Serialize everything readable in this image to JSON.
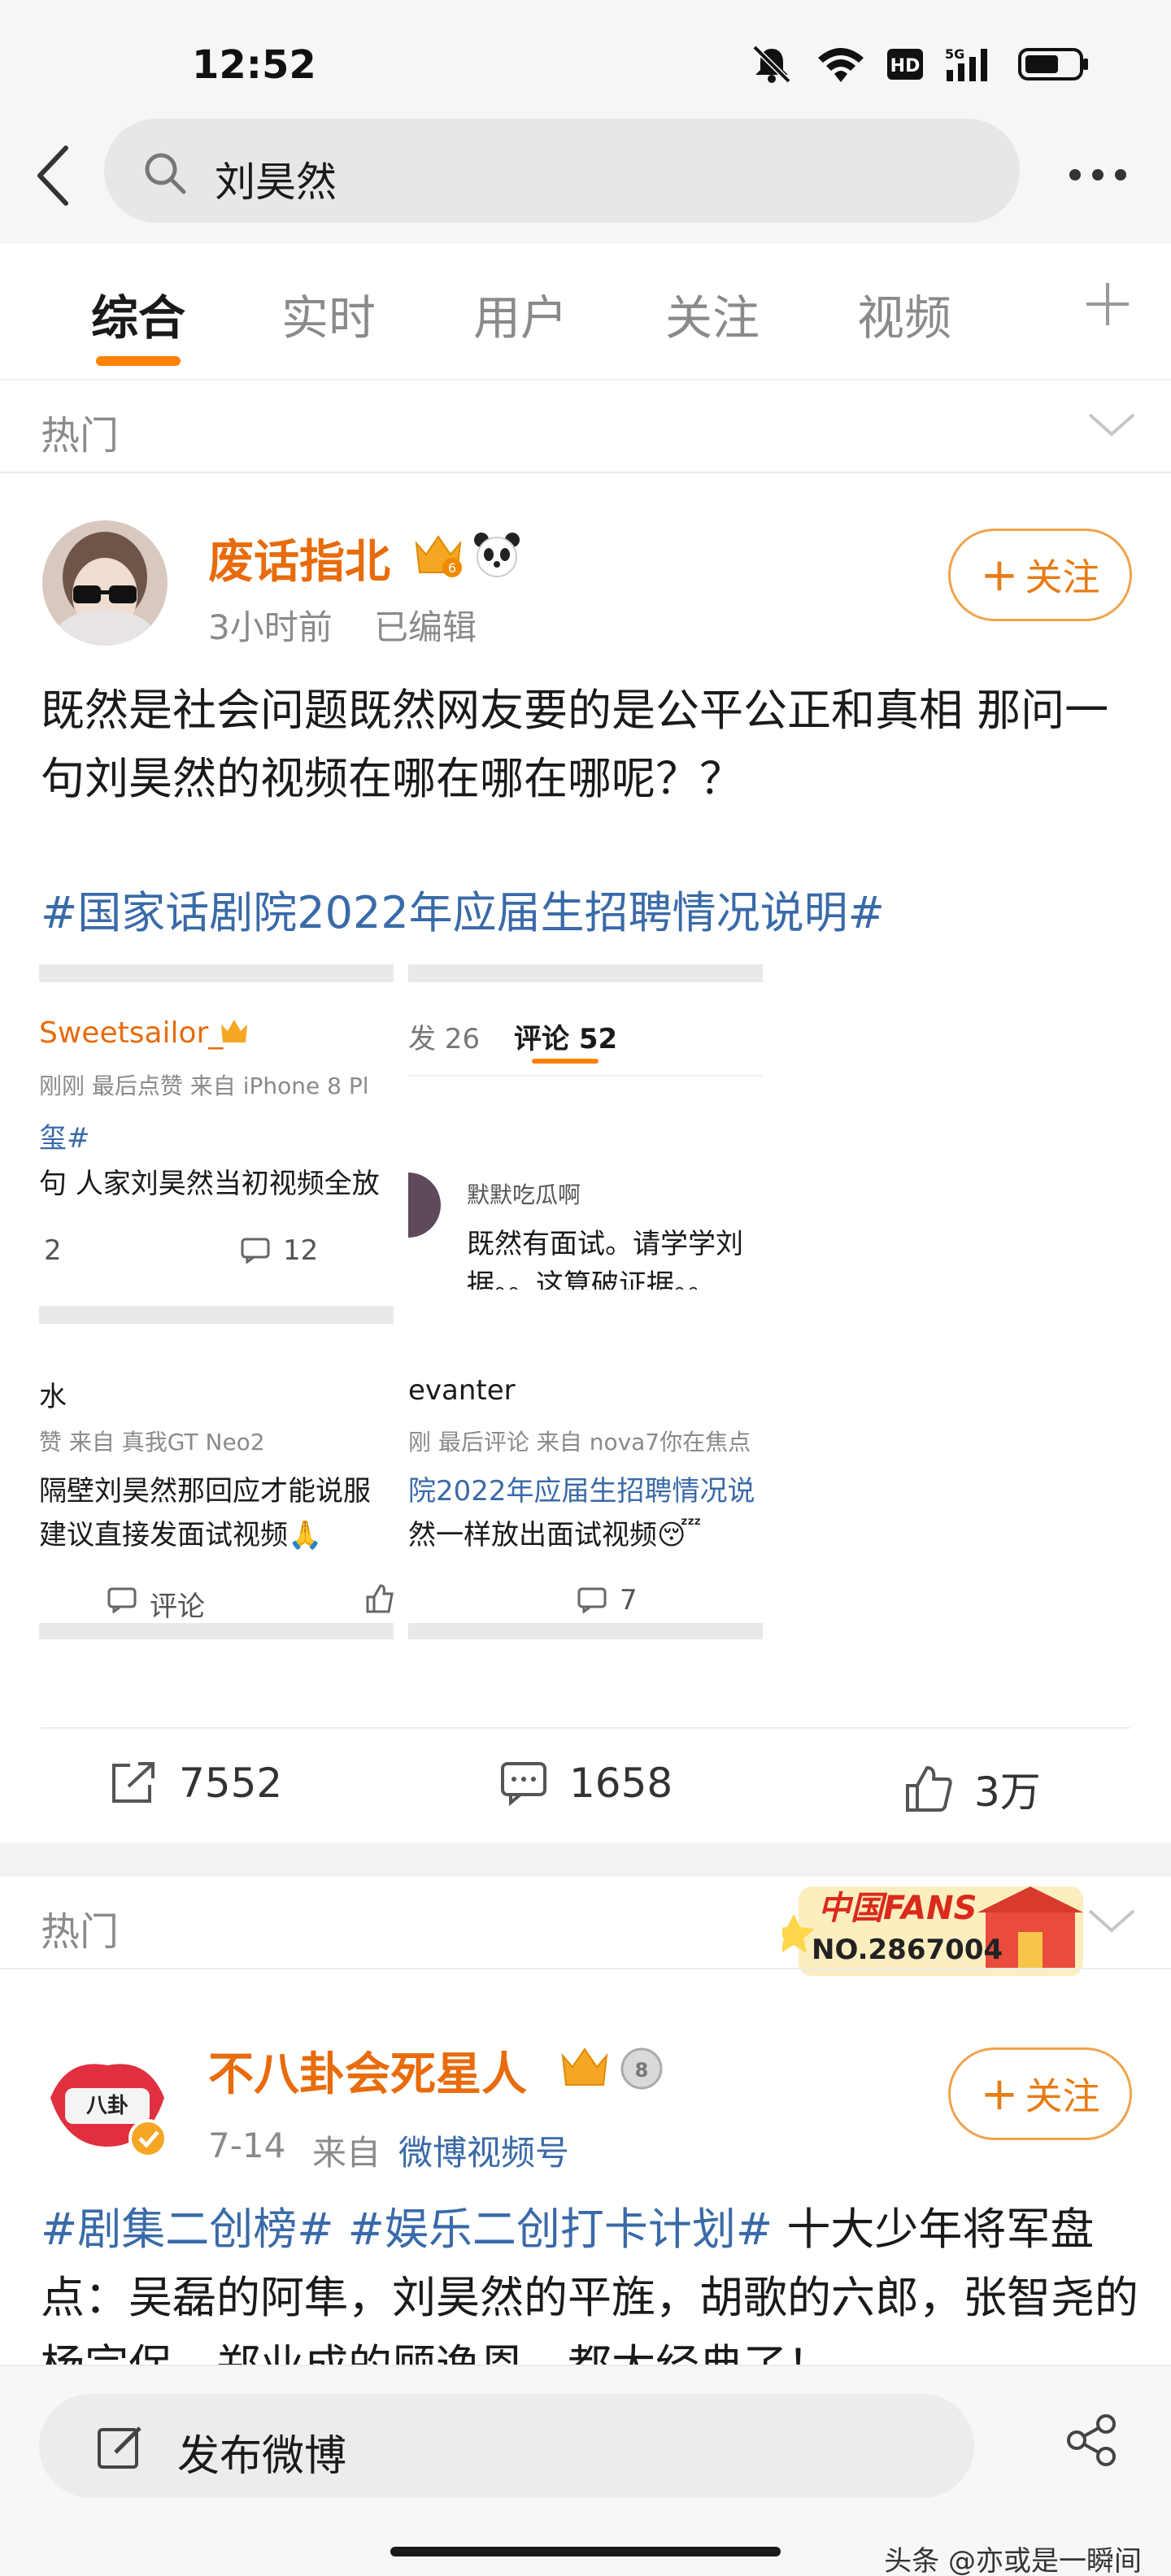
{
  "status_bar": {
    "time": "12:52"
  },
  "search": {
    "query": "刘昊然"
  },
  "tabs": [
    {
      "label": "综合"
    },
    {
      "label": "实时"
    },
    {
      "label": "用户"
    },
    {
      "label": "关注"
    },
    {
      "label": "视频"
    }
  ],
  "sections": [
    {
      "label": "热门"
    },
    {
      "label": "热门"
    }
  ],
  "posts": [
    {
      "author": "废话指北",
      "time": "3小时前",
      "edited": "已编辑",
      "follow_label": "关注",
      "body": "既然是社会问题既然网友要的是公平公正和真相 那问一句刘昊然的视频在哪在哪在哪呢？？",
      "topic": "#国家话剧院2022年应届生招聘情况说明#",
      "reposts": "7552",
      "comments": "1658",
      "likes": "3万",
      "collage": {
        "t1_name": "Sweetsailor_",
        "t1_meta": "刚刚  最后点赞  来自 iPhone 8 Pl",
        "t1_tag": "玺#",
        "t1_text": "句 人家刘昊然当初视频全放",
        "t1_count_a": "2",
        "t1_count_b": "12",
        "t2_tab_a": "发 26",
        "t2_tab_b": "评论 52",
        "t2_name": "默默吃瓜啊",
        "t2_line1": "既然有面试。请学学刘",
        "t2_line2": "据。。这算破证据。。",
        "t3_name": "水",
        "t3_meta": "赞  来自 真我GT Neo2",
        "t3_line1": "隔壁刘昊然那回应才能说服",
        "t3_line2": "建议直接发面试视频🙏",
        "t3_action": "评论",
        "t4_name": "evanter",
        "t4_meta": "刚 最后评论  来自 nova7你在焦点",
        "t4_line1": "院2022年应届生招聘情况说",
        "t4_line2": "然一样放出面试视频😴",
        "t4_count": "7"
      }
    },
    {
      "author": "不八卦会死星人",
      "time": "7-14",
      "source_prefix": "来自",
      "source": "微博视频号",
      "follow_label": "关注",
      "body_tag1": "#剧集二创榜#",
      "body_tag2": "#娱乐二创打卡计划#",
      "body_text": "十大少年将军盘点：吴磊的阿隼，刘昊然的平旌，胡歌的六郎，张智尧的杨宗保，郑业成的顾逸恩，都太经典了！"
    }
  ],
  "fans_badge": {
    "title": "中国FANS",
    "number": "NO.2867004"
  },
  "compose": {
    "label": "发布微博"
  },
  "watermark": "头条 @亦或是一瞬间",
  "colors": {
    "accent": "#ff8200",
    "name": "#e86b0c",
    "link": "#3a6aa8"
  }
}
